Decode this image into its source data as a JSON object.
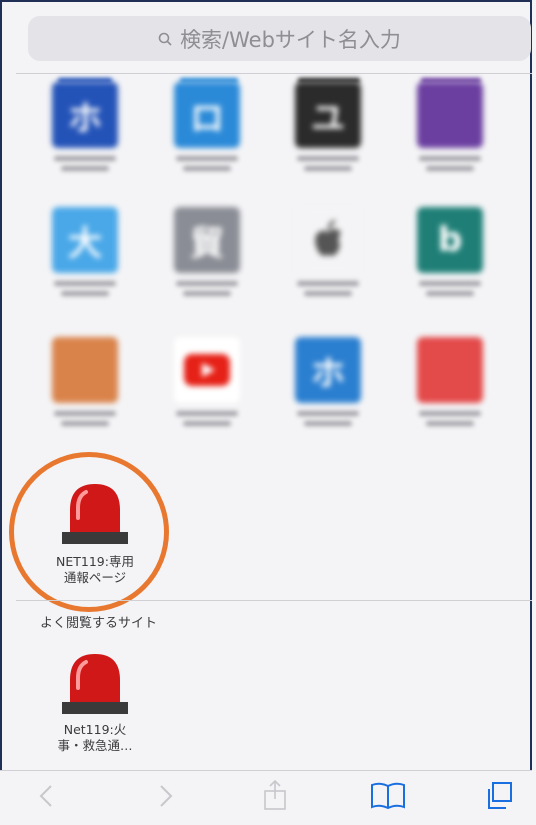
{
  "search": {
    "placeholder": "検索/Webサイト名入力"
  },
  "favorites": {
    "icons": [
      {
        "name": "blurred-favorite-1",
        "glyph": "ホ",
        "color": "#2453b8"
      },
      {
        "name": "blurred-favorite-2",
        "glyph": "ロ",
        "color": "#2b8ad8"
      },
      {
        "name": "blurred-favorite-3",
        "glyph": "ユ",
        "color": "#2b2b2b"
      },
      {
        "name": "blurred-favorite-4",
        "glyph": "",
        "color": "#6b3fa0"
      },
      {
        "name": "blurred-favorite-5",
        "glyph": "大",
        "color": "#4aa8e8"
      },
      {
        "name": "blurred-favorite-6",
        "glyph": "貿",
        "color": "#8a8d95"
      },
      {
        "name": "blurred-favorite-apple",
        "glyph": "",
        "color": "#f4f4f6"
      },
      {
        "name": "blurred-favorite-bing",
        "glyph": "b",
        "color": "#1f7f77"
      },
      {
        "name": "blurred-favorite-9",
        "glyph": "",
        "color": "#d9834a"
      },
      {
        "name": "blurred-favorite-youtube",
        "glyph": "",
        "color": "#ffffff"
      },
      {
        "name": "blurred-favorite-11",
        "glyph": "ホ",
        "color": "#2b7fd0"
      },
      {
        "name": "blurred-favorite-12",
        "glyph": "",
        "color": "#e34a4a"
      }
    ],
    "highlighted": {
      "label_line1": "NET119:専用",
      "label_line2": "通報ページ"
    }
  },
  "frequent": {
    "title": "よく閲覧するサイト",
    "item": {
      "label_line1": "Net119:火",
      "label_line2": "事・救急通…"
    }
  },
  "colors": {
    "highlight": "#e8782f",
    "alarm": "#d01818",
    "tint": "#1a6fe0"
  },
  "toolbar_icons": [
    "back-icon",
    "forward-icon",
    "share-icon",
    "bookmarks-icon",
    "tabs-icon"
  ]
}
